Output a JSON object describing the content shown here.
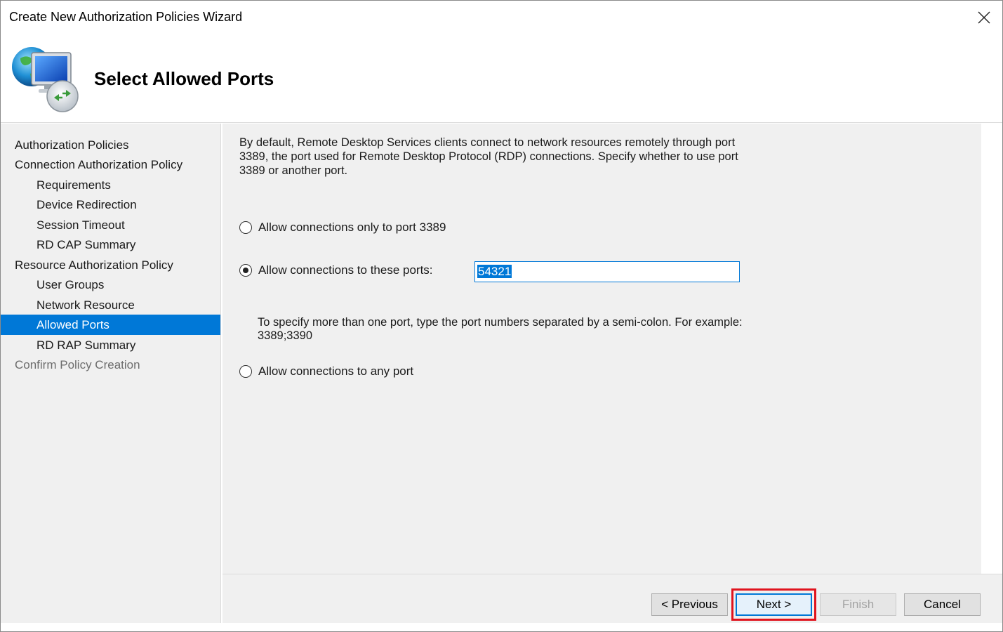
{
  "window": {
    "title": "Create New Authorization Policies Wizard"
  },
  "header": {
    "title": "Select Allowed Ports",
    "icon": "remote-desktop-gateway-icon"
  },
  "nav": {
    "items": [
      {
        "label": "Authorization Policies",
        "level": 0,
        "state": "normal"
      },
      {
        "label": "Connection Authorization Policy",
        "level": 0,
        "state": "normal"
      },
      {
        "label": "Requirements",
        "level": 1,
        "state": "normal"
      },
      {
        "label": "Device Redirection",
        "level": 1,
        "state": "normal"
      },
      {
        "label": "Session Timeout",
        "level": 1,
        "state": "normal"
      },
      {
        "label": "RD CAP Summary",
        "level": 1,
        "state": "normal"
      },
      {
        "label": "Resource Authorization Policy",
        "level": 0,
        "state": "normal"
      },
      {
        "label": "User Groups",
        "level": 1,
        "state": "normal"
      },
      {
        "label": "Network Resource",
        "level": 1,
        "state": "normal"
      },
      {
        "label": "Allowed Ports",
        "level": 1,
        "state": "selected"
      },
      {
        "label": "RD RAP Summary",
        "level": 1,
        "state": "normal"
      },
      {
        "label": "Confirm Policy Creation",
        "level": 0,
        "state": "disabled"
      }
    ]
  },
  "content": {
    "description": "By default, Remote Desktop Services clients connect to network resources remotely through port 3389, the port used for Remote Desktop Protocol (RDP) connections. Specify whether to use port 3389 or another port.",
    "options": {
      "only_3389": {
        "label": "Allow connections only to port 3389",
        "checked": false
      },
      "these_ports": {
        "label": "Allow connections to these ports:",
        "checked": true
      },
      "any_port": {
        "label": "Allow connections to any port",
        "checked": false
      }
    },
    "ports_value": "54321",
    "hint_line1": "To specify more than one port, type the port numbers separated by a semi-colon. For example:",
    "hint_line2": "3389;3390"
  },
  "footer": {
    "previous_label": "< Previous",
    "next_label": "Next >",
    "finish_label": "Finish",
    "cancel_label": "Cancel"
  },
  "colors": {
    "accent": "#0078d7",
    "highlight_box": "#e0141e",
    "panel_background": "#f0f0f0"
  }
}
